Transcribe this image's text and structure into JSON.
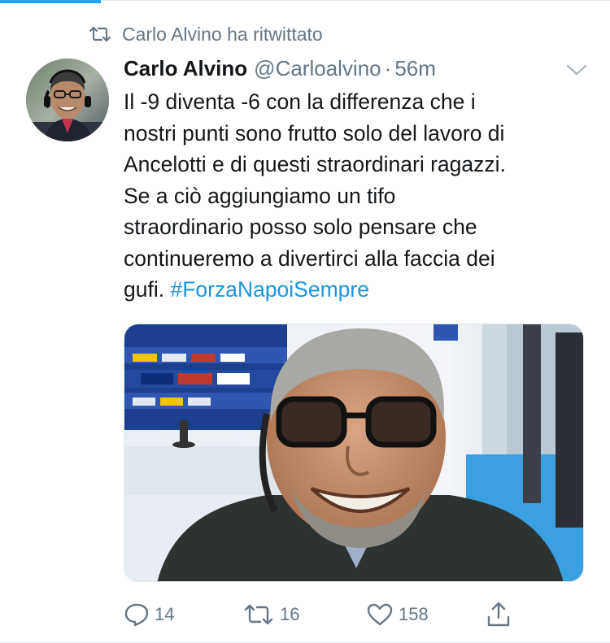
{
  "retweet_context": {
    "icon": "retweet-icon",
    "text": "Carlo Alvino ha ritwittato"
  },
  "tweet": {
    "display_name": "Carlo Alvino",
    "handle": "@Carloalvino",
    "separator": "·",
    "time": "56m",
    "text_lines": [
      "Il -9 diventa -6 con la differenza che i",
      "nostri punti sono frutto solo del lavoro di",
      "Ancelotti e di questi straordinari ragazzi.",
      "Se a ciò aggiungiamo un tifo",
      "straordinario posso solo pensare che",
      "continueremo a divertirci alla faccia dei",
      "gufi."
    ],
    "hashtag": "#ForzaNapoiSempre",
    "media_description": "selfie photo"
  },
  "actions": {
    "reply_count": "14",
    "retweet_count": "16",
    "like_count": "158"
  },
  "colors": {
    "accent": "#1da1f2",
    "link": "#1b95e0",
    "secondary_text": "#657786",
    "primary_text": "#14171a"
  }
}
